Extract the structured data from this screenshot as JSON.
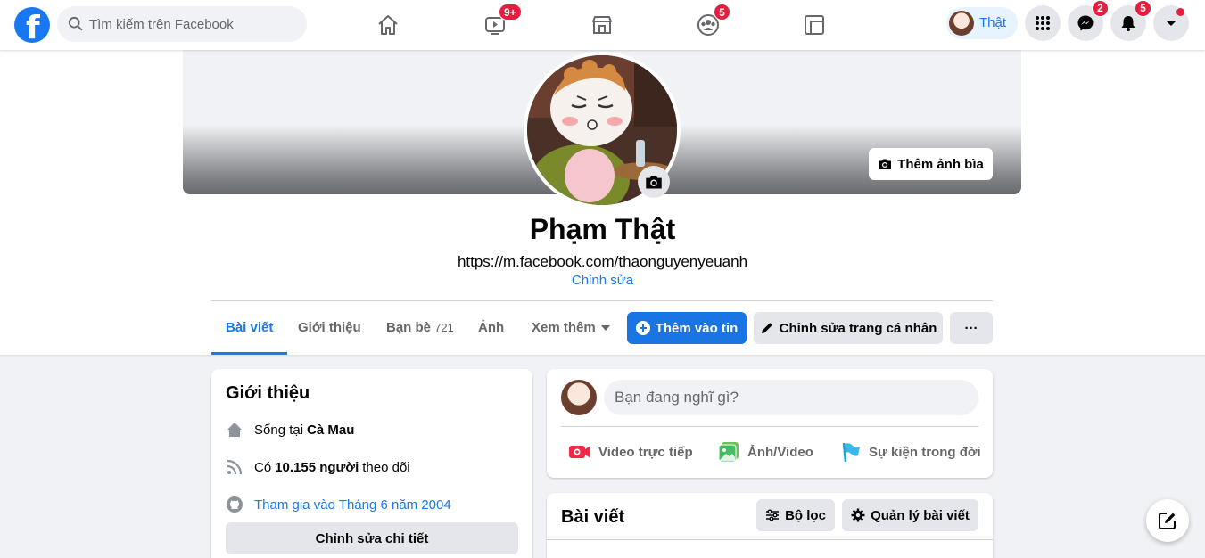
{
  "topbar": {
    "logo_letter": "f",
    "search_placeholder": "Tìm kiếm trên Facebook",
    "nav": [
      {
        "name": "home",
        "badge": ""
      },
      {
        "name": "watch",
        "badge": "9+"
      },
      {
        "name": "marketplace",
        "badge": ""
      },
      {
        "name": "groups",
        "badge": "5"
      },
      {
        "name": "gaming",
        "badge": ""
      }
    ],
    "profile_label": "Thật",
    "messenger_badge": "2",
    "notifications_badge": "5"
  },
  "profile": {
    "add_cover_label": "Thêm ảnh bìa",
    "name": "Phạm Thật",
    "bio": "https://m.facebook.com/thaonguyenyeuanh",
    "edit_bio_label": "Chỉnh sửa",
    "tabs": [
      {
        "label": "Bài viết",
        "count": ""
      },
      {
        "label": "Giới thiệu",
        "count": ""
      },
      {
        "label": "Bạn bè",
        "count": "721"
      },
      {
        "label": "Ảnh",
        "count": ""
      },
      {
        "label": "Xem thêm",
        "count": ""
      }
    ],
    "add_story_label": "Thêm vào tin",
    "edit_profile_label": "Chỉnh sửa trang cá nhân",
    "more_label": "···"
  },
  "intro": {
    "title": "Giới thiệu",
    "lives_prefix": "Sống tại",
    "lives_place": "Cà Mau",
    "followers_prefix": "Có",
    "followers_count": "10.155 người",
    "followers_suffix": "theo dõi",
    "joined": "Tham gia vào Tháng 6 năm 2004",
    "edit_details_label": "Chỉnh sửa chi tiết"
  },
  "composer": {
    "placeholder": "Bạn đang nghĩ gì?",
    "actions": [
      "Video trực tiếp",
      "Ảnh/Video",
      "Sự kiện trong đời"
    ]
  },
  "posts": {
    "title": "Bài viết",
    "filter_label": "Bộ lọc",
    "manage_label": "Quản lý bài viết"
  },
  "colors": {
    "accent": "#1877f2",
    "badge": "#e41e3f",
    "background": "#f0f2f5"
  }
}
